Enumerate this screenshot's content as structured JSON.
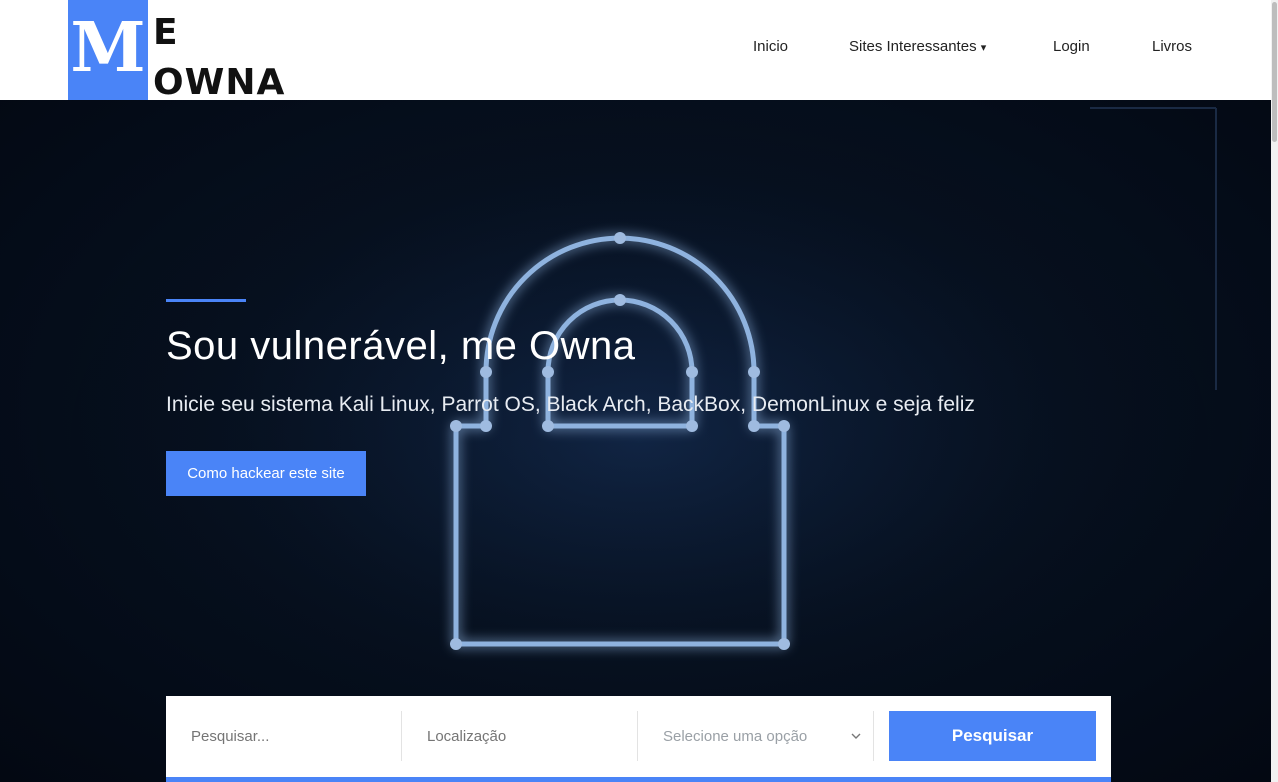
{
  "logo": {
    "letter": "M",
    "line1": "E",
    "line2": "OWNA"
  },
  "nav": {
    "items": [
      {
        "label": "Inicio"
      },
      {
        "label": "Sites Interessantes",
        "caret": "▾"
      },
      {
        "label": "Login"
      },
      {
        "label": "Livros"
      }
    ]
  },
  "hero": {
    "title": "Sou vulnerável, me Owna",
    "subtitle": "Inicie seu sistema Kali Linux, Parrot OS, Black Arch, BackBox, DemonLinux e seja feliz",
    "cta_label": "Como hackear este site",
    "background_icon": "padlock-circuit"
  },
  "search": {
    "keyword_placeholder": "Pesquisar...",
    "location_placeholder": "Localização",
    "select_value": "Selecione uma opção",
    "button_label": "Pesquisar"
  },
  "colors": {
    "accent": "#4a84f7",
    "hero_bg": "#06101f",
    "header_bg": "#ffffff"
  }
}
